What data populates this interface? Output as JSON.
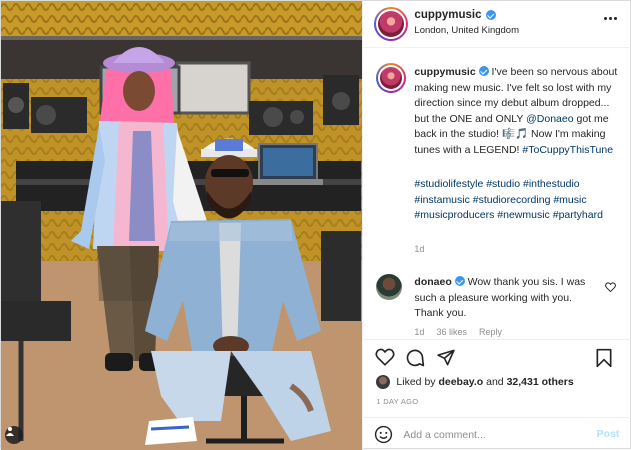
{
  "header": {
    "username": "cuppymusic",
    "location": "London, United Kingdom",
    "verified": true
  },
  "caption": {
    "username": "cuppymusic",
    "text_1": "I've been so nervous about making new music. I've felt so lost with my direction since my debut album dropped... but the ONE and ONLY ",
    "mention": "@Donaeo",
    "text_2": " got me back in the studio! ",
    "emoji": "🎼🎵",
    "text_3": " Now I'm making tunes with a LEGEND! ",
    "hashtag_inline": "#ToCuppyThisTune",
    "hashtags": "#studiolifestyle #studio #inthestudio #instamusic #studiorecording #music #musicproducers #newmusic #partyhard",
    "time": "1d"
  },
  "reply": {
    "username": "donaeo",
    "text": "Wow thank you sis. I was such a pleasure working with you. Thank you.",
    "time": "1d",
    "likes": "36 likes",
    "reply_label": "Reply"
  },
  "likes": {
    "prefix": "Liked by",
    "user": "deebay.o",
    "and": "and",
    "count": "32,431 others"
  },
  "age": "1 DAY AGO",
  "add_comment": {
    "placeholder": "Add a comment...",
    "post_label": "Post"
  },
  "icons": {
    "more": "more-horizontal-icon",
    "like": "heart-icon",
    "comment": "comment-icon",
    "share": "paper-plane-icon",
    "save": "bookmark-icon",
    "emoji": "emoji-icon",
    "user_tags": "user-tag-icon"
  },
  "colors": {
    "link": "#00376b",
    "verified": "#3897f0",
    "muted": "#8e8e8e",
    "post_disabled": "#b2dffc"
  }
}
